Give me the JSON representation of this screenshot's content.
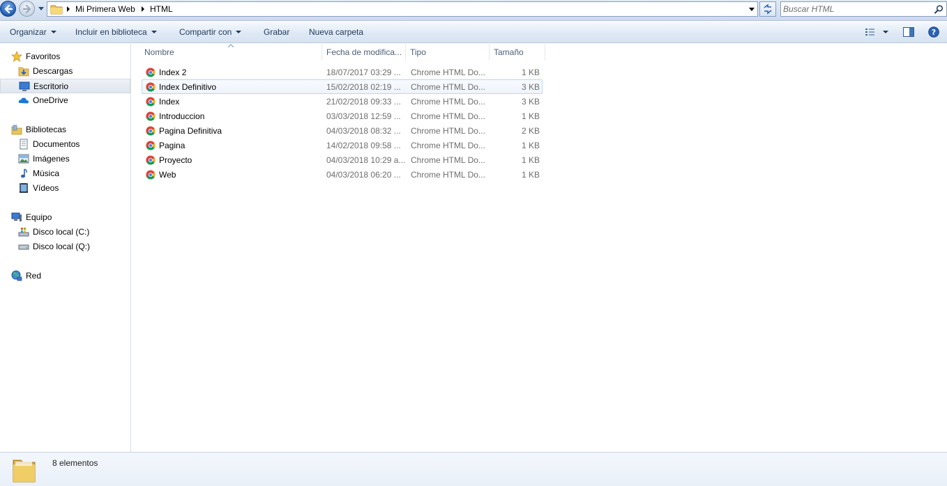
{
  "address_bar": {
    "breadcrumbs": [
      "Mi Primera Web",
      "HTML"
    ],
    "search_placeholder": "Buscar HTML"
  },
  "toolbar": {
    "organizar": "Organizar",
    "incluir": "Incluir en biblioteca",
    "compartir": "Compartir con",
    "grabar": "Grabar",
    "nueva_carpeta": "Nueva carpeta"
  },
  "navigation": {
    "favoritos": "Favoritos",
    "descargas": "Descargas",
    "escritorio": "Escritorio",
    "onedrive": "OneDrive",
    "bibliotecas": "Bibliotecas",
    "documentos": "Documentos",
    "imagenes": "Imágenes",
    "musica": "Música",
    "videos": "Vídeos",
    "equipo": "Equipo",
    "disco_c": "Disco local (C:)",
    "disco_q": "Disco local (Q:)",
    "red": "Red",
    "selected": "Escritorio"
  },
  "file_list": {
    "columns": {
      "name": "Nombre",
      "date": "Fecha de modifica...",
      "type": "Tipo",
      "size": "Tamaño"
    },
    "sort_column": "Nombre",
    "selected_row": "Index Definitivo",
    "rows": [
      {
        "name": "Index 2",
        "date": "18/07/2017 03:29 ...",
        "type": "Chrome HTML Do...",
        "size": "1 KB"
      },
      {
        "name": "Index Definitivo",
        "date": "15/02/2018 02:19 ...",
        "type": "Chrome HTML Do...",
        "size": "3 KB"
      },
      {
        "name": "Index",
        "date": "21/02/2018 09:33 ...",
        "type": "Chrome HTML Do...",
        "size": "3 KB"
      },
      {
        "name": "Introduccion",
        "date": "03/03/2018 12:59 ...",
        "type": "Chrome HTML Do...",
        "size": "1 KB"
      },
      {
        "name": "Pagina Definitiva",
        "date": "04/03/2018 08:32 ...",
        "type": "Chrome HTML Do...",
        "size": "2 KB"
      },
      {
        "name": "Pagina",
        "date": "14/02/2018 09:58 ...",
        "type": "Chrome HTML Do...",
        "size": "1 KB"
      },
      {
        "name": "Proyecto",
        "date": "04/03/2018 10:29 a...",
        "type": "Chrome HTML Do...",
        "size": "1 KB"
      },
      {
        "name": "Web",
        "date": "04/03/2018 06:20 ...",
        "type": "Chrome HTML Do...",
        "size": "1 KB"
      }
    ]
  },
  "status_bar": {
    "count": "8 elementos"
  },
  "icons": {
    "file": "chrome-html-icon",
    "folder": "folder-icon"
  },
  "colors": {
    "selection_border": "#b8d6fb",
    "link_text": "#1e395b"
  }
}
